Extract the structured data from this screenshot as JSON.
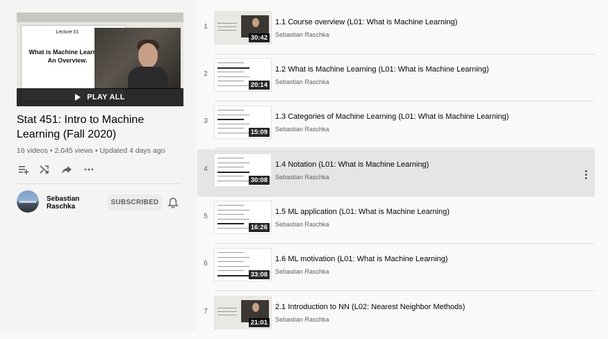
{
  "hero": {
    "slide_lecture": "Lecture 01",
    "slide_title_line1": "What is Machine Learning",
    "slide_title_line2": "An Overview.",
    "play_all_label": "PLAY ALL"
  },
  "playlist": {
    "title": "Stat 451: Intro to Machine Learning (Fall 2020)",
    "videos_count": "16 videos",
    "views": "2,045 views",
    "updated": "Updated 4 days ago",
    "meta_separator": "•"
  },
  "owner": {
    "name": "Sebastian Raschka",
    "subscribe_label": "SUBSCRIBED"
  },
  "icons": {
    "add_to_queue": "add-to-queue-icon",
    "shuffle": "shuffle-icon",
    "share": "share-icon",
    "more": "more-horizontal-icon",
    "bell": "bell-icon"
  },
  "colors": {
    "sidebar_bg": "#f4f4f4",
    "selected_row_bg": "#e5e5e5",
    "text_primary": "#030303",
    "text_secondary": "#606060"
  },
  "videos": [
    {
      "index": "1",
      "title": "1.1 Course overview (L01: What is Machine Learning)",
      "channel": "Sebastian Raschka",
      "duration": "30:42"
    },
    {
      "index": "2",
      "title": "1.2 What is Machine Learning (L01: What is Machine Learning)",
      "channel": "Sebastian Raschka",
      "duration": "20:14"
    },
    {
      "index": "3",
      "title": "1.3 Categories of Machine Learning (L01: What is Machine Learning)",
      "channel": "Sebastian Raschka",
      "duration": "15:09"
    },
    {
      "index": "4",
      "title": "1.4 Notation (L01: What is Machine Learning)",
      "channel": "Sebastian Raschka",
      "duration": "30:08"
    },
    {
      "index": "5",
      "title": "1.5 ML application (L01: What is Machine Learning)",
      "channel": "Sebastian Raschka",
      "duration": "16:26"
    },
    {
      "index": "6",
      "title": "1.6 ML motivation (L01: What is Machine Learning)",
      "channel": "Sebastian Raschka",
      "duration": "33:08"
    },
    {
      "index": "7",
      "title": "2.1 Introduction to NN (L02: Nearest Neighbor Methods)",
      "channel": "Sebastian Raschka",
      "duration": "21:01"
    }
  ]
}
